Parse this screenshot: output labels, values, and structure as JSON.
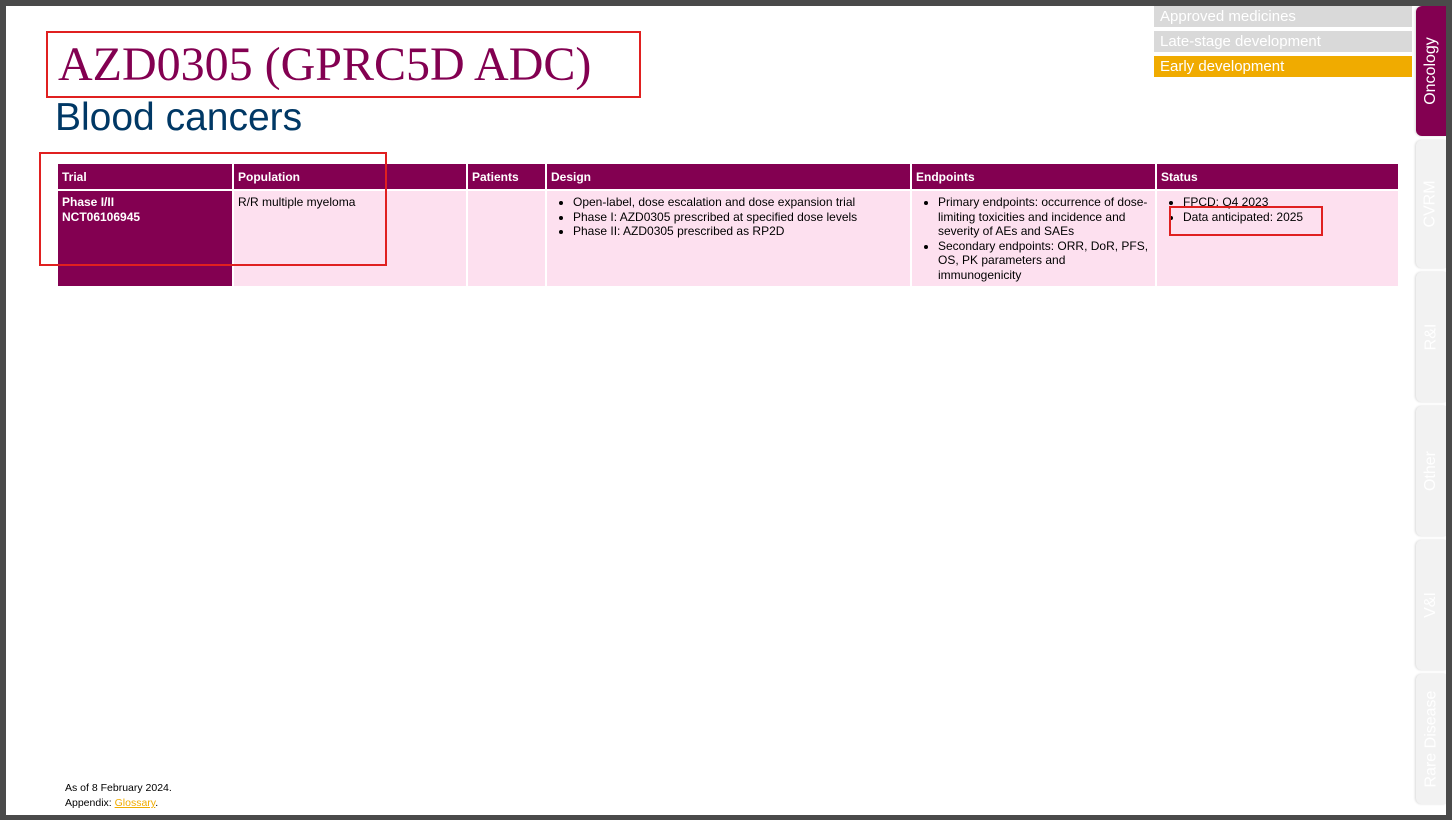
{
  "header": {
    "title": "AZD0305 (GPRC5D ADC)",
    "subtitle": "Blood cancers"
  },
  "stage_legend": [
    {
      "label": "Approved medicines",
      "active": false
    },
    {
      "label": "Late-stage development",
      "active": false
    },
    {
      "label": "Early development",
      "active": true
    }
  ],
  "side_tabs": [
    {
      "label": "Oncology",
      "active": true
    },
    {
      "label": "CVRM",
      "active": false
    },
    {
      "label": "R&I",
      "active": false
    },
    {
      "label": "Other",
      "active": false
    },
    {
      "label": "V&I",
      "active": false
    },
    {
      "label": "Rare Disease",
      "active": false
    }
  ],
  "table": {
    "headers": [
      "Trial",
      "Population",
      "Patients",
      "Design",
      "Endpoints",
      "Status"
    ],
    "row": {
      "trial_phase": "Phase I/II",
      "trial_id": "NCT06106945",
      "population": "R/R multiple myeloma",
      "patients": "",
      "design": [
        "Open-label, dose escalation and dose expansion trial",
        "Phase I: AZD0305 prescribed at specified dose levels",
        "Phase II: AZD0305 prescribed as RP2D"
      ],
      "endpoints": [
        "Primary endpoints: occurrence of dose-limiting toxicities and incidence and severity of AEs and SAEs",
        "Secondary endpoints: ORR, DoR, PFS, OS, PK parameters and immunogenicity"
      ],
      "status": [
        "FPCD: Q4 2023",
        "Data anticipated: 2025"
      ]
    }
  },
  "footer": {
    "as_of": "As of 8 February 2024.",
    "appendix_prefix": "Appendix: ",
    "glossary_link": "Glossary",
    "appendix_suffix": "."
  },
  "colors": {
    "brand": "#830051",
    "accent": "#f0ab00",
    "subtitle": "#003865",
    "cell_fill": "#fde0ef",
    "highlight": "#e02020"
  }
}
